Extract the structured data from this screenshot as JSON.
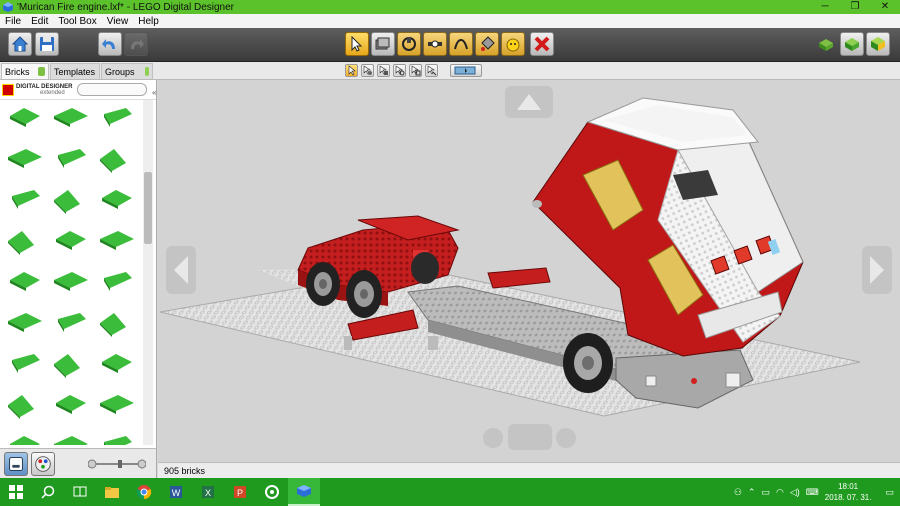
{
  "window": {
    "title": "'Murican Fire engine.lxf* - LEGO Digital Designer",
    "minimize": "─",
    "maximize": "❐",
    "close": "✕"
  },
  "menu": [
    "File",
    "Edit",
    "Tool Box",
    "View",
    "Help"
  ],
  "tabs": [
    {
      "label": "Bricks"
    },
    {
      "label": "Templates"
    },
    {
      "label": "Groups"
    }
  ],
  "palette": {
    "logo_line1": "DIGITAL DESIGNER",
    "logo_line2": "extended",
    "search_placeholder": "",
    "collapse": "«"
  },
  "status": {
    "bricks": "905 bricks"
  },
  "clock": {
    "time": "18:01",
    "date": "2018. 07. 31."
  },
  "colors": {
    "titlebar": "#5cc22b",
    "brick_green": "#2fa52f",
    "brick_red": "#b31818",
    "brick_white": "#f2f2f2",
    "taskbar": "#1f9a1f",
    "active_tool": "#f0b030"
  }
}
